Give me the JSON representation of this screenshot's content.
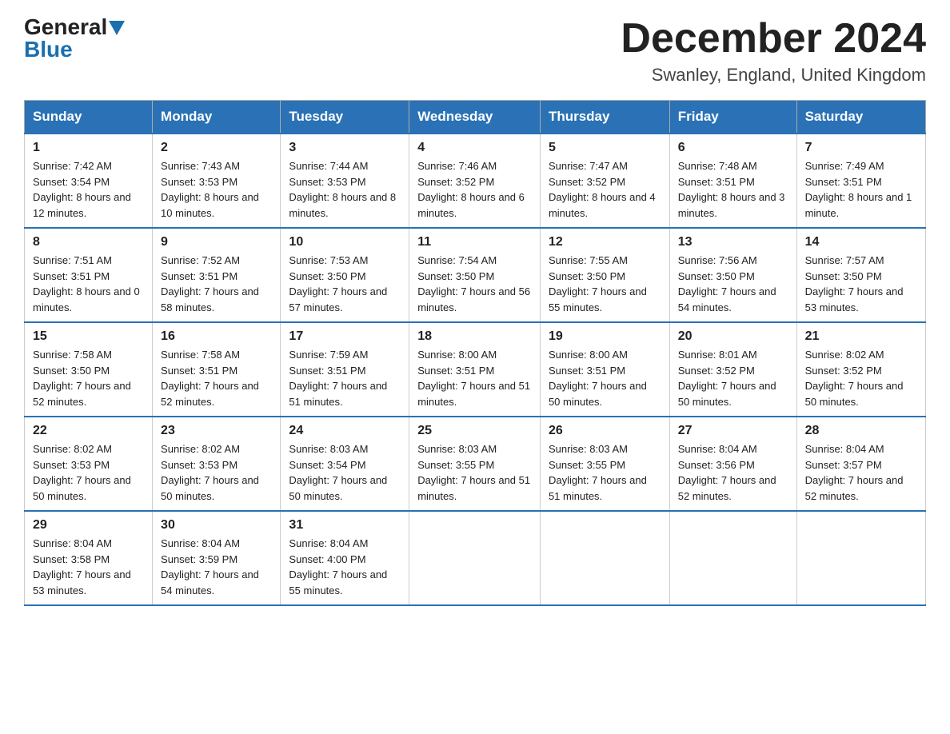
{
  "header": {
    "logo_general": "General",
    "logo_blue": "Blue",
    "month_title": "December 2024",
    "location": "Swanley, England, United Kingdom"
  },
  "days_of_week": [
    "Sunday",
    "Monday",
    "Tuesday",
    "Wednesday",
    "Thursday",
    "Friday",
    "Saturday"
  ],
  "weeks": [
    [
      {
        "day": "1",
        "sunrise": "7:42 AM",
        "sunset": "3:54 PM",
        "daylight": "8 hours and 12 minutes."
      },
      {
        "day": "2",
        "sunrise": "7:43 AM",
        "sunset": "3:53 PM",
        "daylight": "8 hours and 10 minutes."
      },
      {
        "day": "3",
        "sunrise": "7:44 AM",
        "sunset": "3:53 PM",
        "daylight": "8 hours and 8 minutes."
      },
      {
        "day": "4",
        "sunrise": "7:46 AM",
        "sunset": "3:52 PM",
        "daylight": "8 hours and 6 minutes."
      },
      {
        "day": "5",
        "sunrise": "7:47 AM",
        "sunset": "3:52 PM",
        "daylight": "8 hours and 4 minutes."
      },
      {
        "day": "6",
        "sunrise": "7:48 AM",
        "sunset": "3:51 PM",
        "daylight": "8 hours and 3 minutes."
      },
      {
        "day": "7",
        "sunrise": "7:49 AM",
        "sunset": "3:51 PM",
        "daylight": "8 hours and 1 minute."
      }
    ],
    [
      {
        "day": "8",
        "sunrise": "7:51 AM",
        "sunset": "3:51 PM",
        "daylight": "8 hours and 0 minutes."
      },
      {
        "day": "9",
        "sunrise": "7:52 AM",
        "sunset": "3:51 PM",
        "daylight": "7 hours and 58 minutes."
      },
      {
        "day": "10",
        "sunrise": "7:53 AM",
        "sunset": "3:50 PM",
        "daylight": "7 hours and 57 minutes."
      },
      {
        "day": "11",
        "sunrise": "7:54 AM",
        "sunset": "3:50 PM",
        "daylight": "7 hours and 56 minutes."
      },
      {
        "day": "12",
        "sunrise": "7:55 AM",
        "sunset": "3:50 PM",
        "daylight": "7 hours and 55 minutes."
      },
      {
        "day": "13",
        "sunrise": "7:56 AM",
        "sunset": "3:50 PM",
        "daylight": "7 hours and 54 minutes."
      },
      {
        "day": "14",
        "sunrise": "7:57 AM",
        "sunset": "3:50 PM",
        "daylight": "7 hours and 53 minutes."
      }
    ],
    [
      {
        "day": "15",
        "sunrise": "7:58 AM",
        "sunset": "3:50 PM",
        "daylight": "7 hours and 52 minutes."
      },
      {
        "day": "16",
        "sunrise": "7:58 AM",
        "sunset": "3:51 PM",
        "daylight": "7 hours and 52 minutes."
      },
      {
        "day": "17",
        "sunrise": "7:59 AM",
        "sunset": "3:51 PM",
        "daylight": "7 hours and 51 minutes."
      },
      {
        "day": "18",
        "sunrise": "8:00 AM",
        "sunset": "3:51 PM",
        "daylight": "7 hours and 51 minutes."
      },
      {
        "day": "19",
        "sunrise": "8:00 AM",
        "sunset": "3:51 PM",
        "daylight": "7 hours and 50 minutes."
      },
      {
        "day": "20",
        "sunrise": "8:01 AM",
        "sunset": "3:52 PM",
        "daylight": "7 hours and 50 minutes."
      },
      {
        "day": "21",
        "sunrise": "8:02 AM",
        "sunset": "3:52 PM",
        "daylight": "7 hours and 50 minutes."
      }
    ],
    [
      {
        "day": "22",
        "sunrise": "8:02 AM",
        "sunset": "3:53 PM",
        "daylight": "7 hours and 50 minutes."
      },
      {
        "day": "23",
        "sunrise": "8:02 AM",
        "sunset": "3:53 PM",
        "daylight": "7 hours and 50 minutes."
      },
      {
        "day": "24",
        "sunrise": "8:03 AM",
        "sunset": "3:54 PM",
        "daylight": "7 hours and 50 minutes."
      },
      {
        "day": "25",
        "sunrise": "8:03 AM",
        "sunset": "3:55 PM",
        "daylight": "7 hours and 51 minutes."
      },
      {
        "day": "26",
        "sunrise": "8:03 AM",
        "sunset": "3:55 PM",
        "daylight": "7 hours and 51 minutes."
      },
      {
        "day": "27",
        "sunrise": "8:04 AM",
        "sunset": "3:56 PM",
        "daylight": "7 hours and 52 minutes."
      },
      {
        "day": "28",
        "sunrise": "8:04 AM",
        "sunset": "3:57 PM",
        "daylight": "7 hours and 52 minutes."
      }
    ],
    [
      {
        "day": "29",
        "sunrise": "8:04 AM",
        "sunset": "3:58 PM",
        "daylight": "7 hours and 53 minutes."
      },
      {
        "day": "30",
        "sunrise": "8:04 AM",
        "sunset": "3:59 PM",
        "daylight": "7 hours and 54 minutes."
      },
      {
        "day": "31",
        "sunrise": "8:04 AM",
        "sunset": "4:00 PM",
        "daylight": "7 hours and 55 minutes."
      },
      null,
      null,
      null,
      null
    ]
  ]
}
